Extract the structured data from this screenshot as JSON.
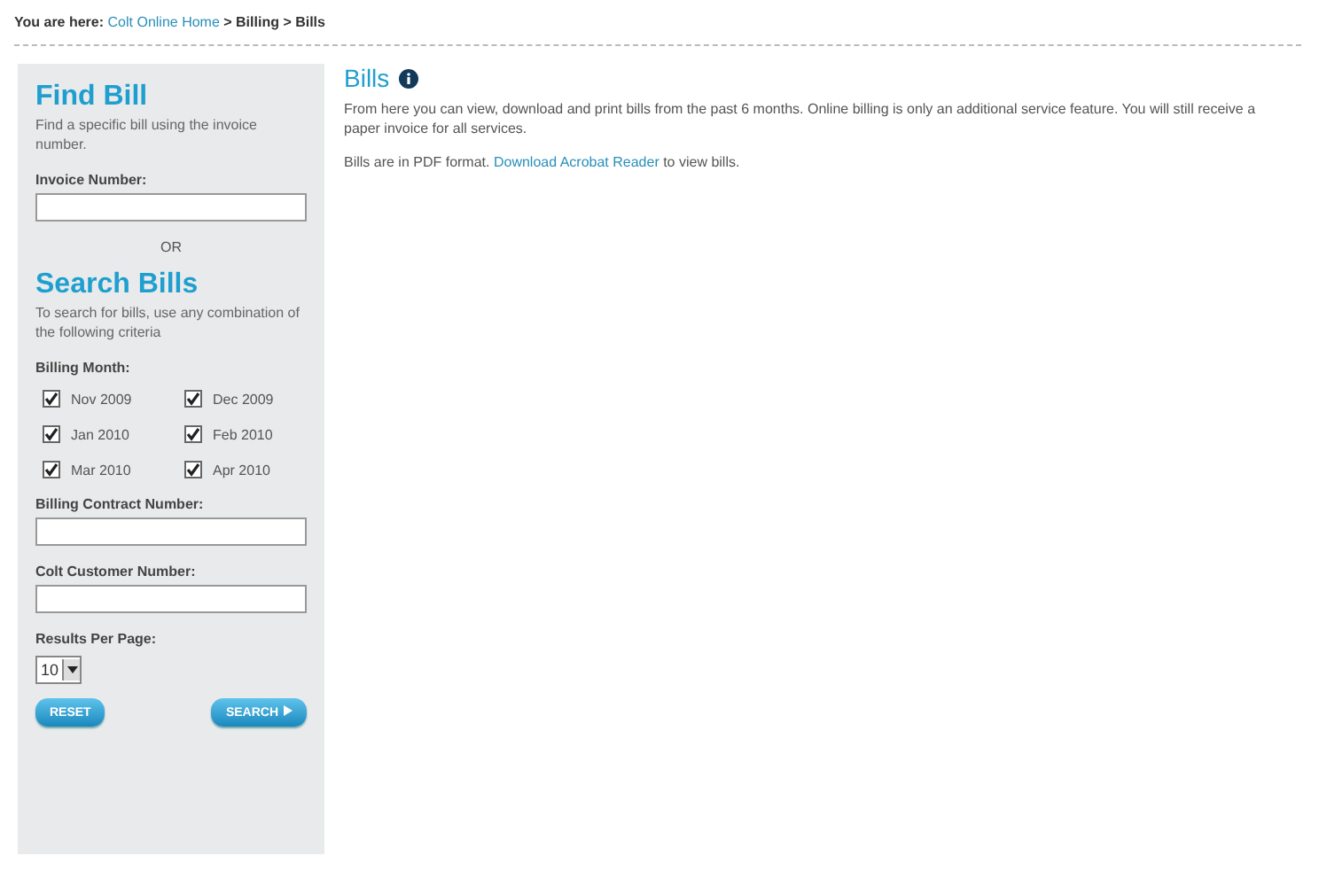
{
  "breadcrumb": {
    "label": "You are here:",
    "link": "Colt Online Home",
    "trail": "> Billing > Bills"
  },
  "find_bill": {
    "title": "Find Bill",
    "description": "Find a specific bill using the invoice number.",
    "invoice_label": "Invoice Number:",
    "separator": "OR"
  },
  "search_bills": {
    "title": "Search Bills",
    "description": "To search for bills, use any combination of the following criteria",
    "month_label": "Billing Month:",
    "months": [
      {
        "label": "Nov 2009",
        "checked": true
      },
      {
        "label": "Dec 2009",
        "checked": true
      },
      {
        "label": "Jan 2010",
        "checked": true
      },
      {
        "label": "Feb 2010",
        "checked": true
      },
      {
        "label": "Mar 2010",
        "checked": true
      },
      {
        "label": "Apr 2010",
        "checked": true
      }
    ],
    "contract_label": "Billing Contract Number:",
    "customer_label": "Colt Customer Number:",
    "results_label": "Results Per Page:",
    "results_value": "10",
    "reset_button": "RESET",
    "search_button": "SEARCH"
  },
  "main": {
    "title": "Bills",
    "intro": "From here you can view, download and print bills from the past 6 months. Online billing is only an additional service feature. You will still receive a paper invoice for all services.",
    "pdf_text": "Bills are in PDF format.",
    "pdf_link": "Download Acrobat Reader",
    "pdf_after": "to view bills."
  }
}
